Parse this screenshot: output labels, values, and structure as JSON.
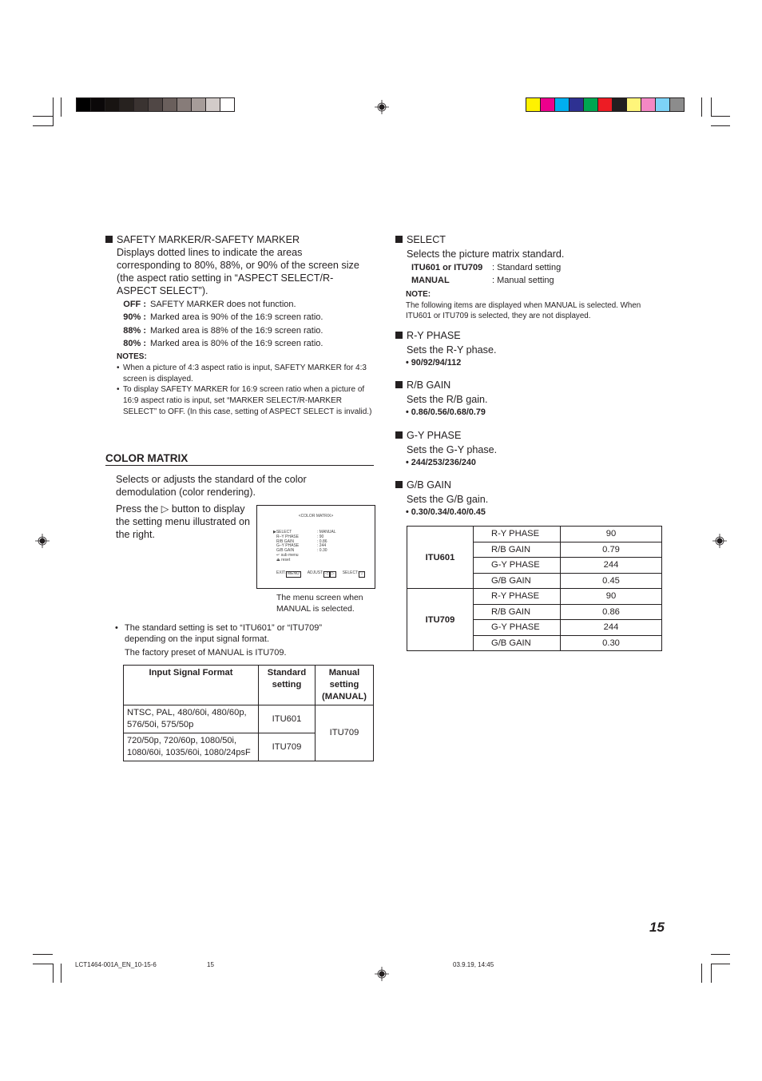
{
  "print_marks": {
    "grayscale_swatches": [
      "#000000",
      "#0b0809",
      "#181412",
      "#27221f",
      "#3a3331",
      "#504745",
      "#6a5f5c",
      "#877c79",
      "#a69c99",
      "#d2cbc9",
      "#ffffff"
    ],
    "color_swatches": [
      "#fff200",
      "#ec008c",
      "#00aeef",
      "#2e3192",
      "#00a651",
      "#ed1c24",
      "#231f20",
      "#fff57a",
      "#f488c4",
      "#7dd3f7",
      "#8c8c8c"
    ]
  },
  "left": {
    "safety_marker": {
      "heading": "SAFETY MARKER/R-SAFETY MARKER",
      "description_lines": [
        "Displays dotted lines to indicate the areas",
        "corresponding to 80%, 88%, or 90% of the screen size",
        "(the aspect ratio setting in “ASPECT SELECT/R-",
        "ASPECT SELECT”)."
      ],
      "options": [
        {
          "key": "OFF :",
          "text": "SAFETY MARKER does not function."
        },
        {
          "key": "90% :",
          "text": "Marked area is 90% of the 16:9 screen ratio."
        },
        {
          "key": "88% :",
          "text": "Marked area is 88% of the 16:9 screen ratio."
        },
        {
          "key": "80% :",
          "text": "Marked area is 80% of the 16:9 screen ratio."
        }
      ],
      "notes_title": "NOTES:",
      "notes": [
        "When a picture of 4:3 aspect ratio is input, SAFETY MARKER for 4:3 screen is displayed.",
        "To display SAFETY MARKER for 16:9 screen ratio when a picture of 16:9 aspect ratio is input, set “MARKER SELECT/R-MARKER SELECT” to OFF. (In this case, setting of ASPECT SELECT is invalid.)"
      ]
    },
    "color_matrix": {
      "title": "COLOR MATRIX",
      "description": "Selects or adjusts the standard of the color demodulation (color rendering).",
      "press_text": "Press the ▷ button to display the setting menu illustrated on the right.",
      "osd": {
        "title": "<COLOR MATRIX>",
        "rows": [
          {
            "label": "▶SELECT",
            "value": ": MANUAL"
          },
          {
            "label": "R–Y PHASE",
            "value": ":   90"
          },
          {
            "label": "R/B GAIN",
            "value": ": 0.86"
          },
          {
            "label": "G–Y PHASE",
            "value": ":  244"
          },
          {
            "label": "G/B GAIN",
            "value": ": 0.30"
          },
          {
            "label": "↵ sub menu",
            "value": ""
          },
          {
            "label": "⏏ reset",
            "value": ""
          }
        ],
        "exit_label": "EXIT:",
        "exit_key": "MENU",
        "adjust_label": "ADJUST:",
        "adjust_keys": [
          "◁",
          "▷"
        ],
        "select_label": "SELECT:",
        "select_key": "▽"
      },
      "osd_caption": "The menu screen when MANUAL is selected.",
      "bullet": "The standard setting is set to “ITU601” or “ITU709” depending on the input signal format.",
      "factory_preset": "The factory preset of MANUAL is ITU709.",
      "signal_table": {
        "headers": [
          "Input Signal Format",
          "Standard setting",
          "Manual setting (MANUAL)"
        ],
        "rows": [
          {
            "format": "NTSC, PAL, 480/60i, 480/60p, 576/50i, 575/50p",
            "standard": "ITU601"
          },
          {
            "format": "720/50p, 720/60p, 1080/50i, 1080/60i, 1035/60i, 1080/24psF",
            "standard": "ITU709"
          }
        ],
        "manual": "ITU709"
      }
    }
  },
  "right": {
    "select": {
      "heading": "SELECT",
      "description": "Selects the picture matrix standard.",
      "options": [
        {
          "key": "ITU601 or ITU709",
          "text": ": Standard setting"
        },
        {
          "key": "MANUAL",
          "text": ": Manual setting"
        }
      ],
      "note_title": "NOTE:",
      "note": "The following items are displayed when MANUAL is selected. When ITU601 or ITU709 is selected, they are not displayed."
    },
    "items": [
      {
        "heading": "R-Y PHASE",
        "description": "Sets the R-Y phase.",
        "values": "• 90/92/94/112"
      },
      {
        "heading": "R/B GAIN",
        "description": "Sets the R/B gain.",
        "values": "• 0.86/0.56/0.68/0.79"
      },
      {
        "heading": "G-Y PHASE",
        "description": "Sets the G-Y phase.",
        "values": "• 244/253/236/240"
      },
      {
        "heading": "G/B GAIN",
        "description": "Sets the G/B gain.",
        "values": "• 0.30/0.34/0.40/0.45"
      }
    ],
    "value_table": [
      {
        "group": "ITU601",
        "rows": [
          {
            "param": "R-Y PHASE",
            "value": "90"
          },
          {
            "param": "R/B GAIN",
            "value": "0.79"
          },
          {
            "param": "G-Y PHASE",
            "value": "244"
          },
          {
            "param": "G/B GAIN",
            "value": "0.45"
          }
        ]
      },
      {
        "group": "ITU709",
        "rows": [
          {
            "param": "R-Y PHASE",
            "value": "90"
          },
          {
            "param": "R/B GAIN",
            "value": "0.86"
          },
          {
            "param": "G-Y PHASE",
            "value": "244"
          },
          {
            "param": "G/B GAIN",
            "value": "0.30"
          }
        ]
      }
    ]
  },
  "page_number": "15",
  "footer": {
    "file_id": "LCT1464-001A_EN_10-15-6",
    "sheet": "15",
    "timestamp": "03.9.19, 14:45"
  }
}
